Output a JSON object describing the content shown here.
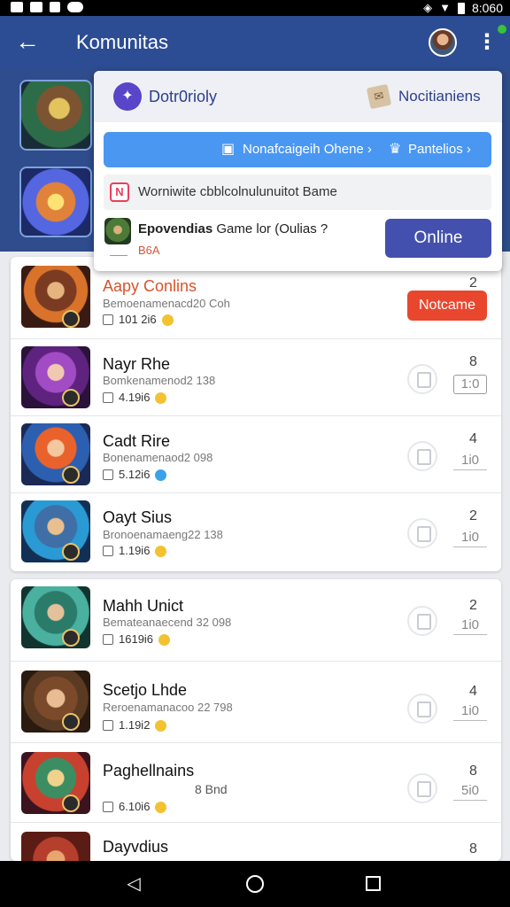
{
  "status_bar": {
    "time": "8:060"
  },
  "app_bar": {
    "title": "Komunitas"
  },
  "overlay": {
    "title": "Dotr0rioly",
    "notifications_label": "Nocitianiens",
    "tabs": [
      {
        "label": "Nonafcaigeih Ohene ›"
      },
      {
        "label": "Pantelios ›"
      }
    ],
    "invite_text": "Worniwite cbblcolnulunuitot Bame",
    "question_title_bold": "Epovendias",
    "question_title_rest": " Game lor (Oulias ?",
    "question_sub": "B6A",
    "online_button": "Online",
    "colors": {
      "header": "#2c4d93",
      "tab_bar": "#4a97f2",
      "online_button": "#4350ad",
      "cta": "#e8472e"
    }
  },
  "list": [
    {
      "title": "Aapy Conlins",
      "subtitle": "Bemoenamenacd20 Coh",
      "meta": "101 2i6",
      "coin": "gold",
      "action_label": "Notcame",
      "rank": "2",
      "score": ""
    },
    {
      "title": "Nayr Rhe",
      "subtitle": "Bomkenamenod2 138",
      "meta": "4.19i6",
      "coin": "gold",
      "action_label": "",
      "rank": "8",
      "score": "1:0"
    },
    {
      "title": "Cadt Rire",
      "subtitle": "Bonenamenaod2 098",
      "meta": "5.12i6",
      "coin": "blue",
      "action_label": "",
      "rank": "4",
      "score": "1i0"
    },
    {
      "title": "Oayt Sius",
      "subtitle": "Bronoenamaeng22 138",
      "meta": "1.19i6",
      "coin": "gold",
      "action_label": "",
      "rank": "2",
      "score": "1i0"
    },
    {
      "title": "Mahh Unict",
      "subtitle": "Bemateanaecend 32 098",
      "meta": "1619i6",
      "coin": "gold",
      "action_label": "",
      "rank": "2",
      "score": "1i0"
    },
    {
      "title": "Scetjo Lhde",
      "subtitle": "Reroenamanacoo 22 798",
      "meta": "1.19i2",
      "coin": "gold",
      "action_label": "",
      "rank": "4",
      "score": "1i0"
    },
    {
      "title": "Paghellnains",
      "subtitle": "",
      "subtitle_right": "8 Bnd",
      "meta": "6.10i6",
      "coin": "gold",
      "action_label": "",
      "rank": "8",
      "score": "5i0"
    },
    {
      "title": "Dayvdius",
      "subtitle": "",
      "meta": "",
      "coin": "",
      "action_label": "",
      "rank": "8",
      "score": ""
    }
  ]
}
